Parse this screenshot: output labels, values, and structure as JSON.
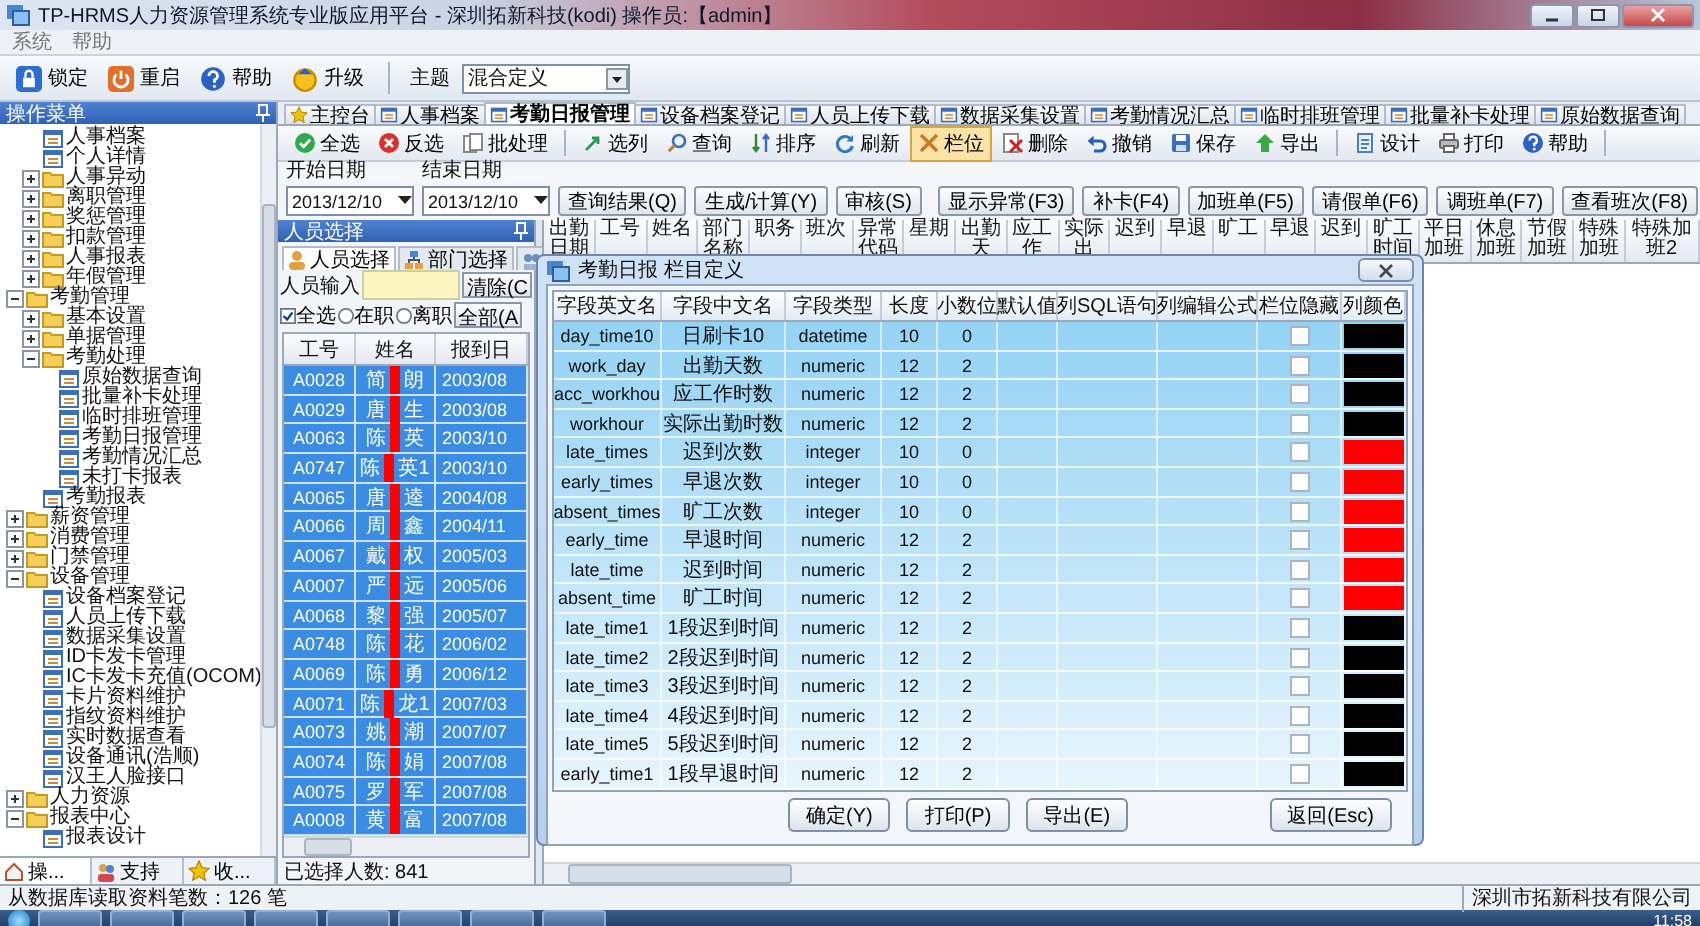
{
  "window": {
    "title": "TP-HRMS人力资源管理系统专业版应用平台 - 深圳拓新科技(kodi) 操作员:【admin】"
  },
  "menu": [
    "系统",
    "帮助"
  ],
  "main_toolbar": [
    {
      "label": "锁定"
    },
    {
      "label": "重启"
    },
    {
      "label": "帮助"
    },
    {
      "label": "升级"
    }
  ],
  "theme": {
    "label": "主题",
    "value": "混合定义"
  },
  "side_panel": {
    "title": "操作菜单",
    "tree": [
      {
        "children": [
          {
            "kind": "leaf",
            "label": "人事档案"
          },
          {
            "kind": "leaf",
            "label": "个人详情"
          },
          {
            "kind": "folder",
            "label": "人事异动",
            "expanded": false
          },
          {
            "kind": "folder",
            "label": "离职管理",
            "expanded": false
          },
          {
            "kind": "folder",
            "label": "奖惩管理",
            "expanded": false
          },
          {
            "kind": "folder",
            "label": "扣款管理",
            "expanded": false
          },
          {
            "kind": "folder",
            "label": "人事报表",
            "expanded": false
          },
          {
            "kind": "folder",
            "label": "年假管理",
            "expanded": false
          }
        ]
      },
      {
        "kind": "folder",
        "label": "考勤管理",
        "expanded": true,
        "children": [
          {
            "kind": "folder",
            "label": "基本设置",
            "expanded": false
          },
          {
            "kind": "folder",
            "label": "单据管理",
            "expanded": false
          },
          {
            "kind": "folder",
            "label": "考勤处理",
            "expanded": true,
            "children": [
              {
                "kind": "leaf",
                "label": "原始数据查询"
              },
              {
                "kind": "leaf",
                "label": "批量补卡处理"
              },
              {
                "kind": "leaf",
                "label": "临时排班管理"
              },
              {
                "kind": "leaf",
                "label": "考勤日报管理"
              },
              {
                "kind": "leaf",
                "label": "考勤情况汇总"
              },
              {
                "kind": "leaf",
                "label": "未打卡报表"
              }
            ]
          },
          {
            "kind": "leaf",
            "label": "考勤报表"
          }
        ]
      },
      {
        "kind": "folder",
        "label": "薪资管理",
        "expanded": false
      },
      {
        "kind": "folder",
        "label": "消费管理",
        "expanded": false
      },
      {
        "kind": "folder",
        "label": "门禁管理",
        "expanded": false
      },
      {
        "kind": "folder",
        "label": "设备管理",
        "expanded": true,
        "children": [
          {
            "kind": "leaf",
            "label": "设备档案登记"
          },
          {
            "kind": "leaf",
            "label": "人员上传下载"
          },
          {
            "kind": "leaf",
            "label": "数据采集设置"
          },
          {
            "kind": "leaf",
            "label": "ID卡发卡管理"
          },
          {
            "kind": "leaf",
            "label": "IC卡发卡充值(OCOM)"
          },
          {
            "kind": "leaf",
            "label": "卡片资料维护"
          },
          {
            "kind": "leaf",
            "label": "指纹资料维护"
          },
          {
            "kind": "leaf",
            "label": "实时数据查看"
          },
          {
            "kind": "leaf",
            "label": "设备通讯(浩顺)"
          },
          {
            "kind": "leaf",
            "label": "汉王人脸接口"
          }
        ]
      },
      {
        "kind": "folder",
        "label": "人力资源",
        "expanded": false
      },
      {
        "kind": "folder",
        "label": "报表中心",
        "expanded": true,
        "children": [
          {
            "kind": "leaf",
            "label": "报表设计"
          }
        ]
      }
    ],
    "tabs": [
      {
        "label": "操...",
        "selected": true
      },
      {
        "label": "支持",
        "selected": false
      },
      {
        "label": "收...",
        "selected": false
      }
    ]
  },
  "tabs": [
    {
      "label": "主控台",
      "selected": false
    },
    {
      "label": "人事档案",
      "selected": false
    },
    {
      "label": "考勤日报管理",
      "selected": true
    },
    {
      "label": "设备档案登记",
      "selected": false
    },
    {
      "label": "人员上传下载",
      "selected": false
    },
    {
      "label": "数据采集设置",
      "selected": false
    },
    {
      "label": "考勤情况汇总",
      "selected": false
    },
    {
      "label": "临时排班管理",
      "selected": false
    },
    {
      "label": "批量补卡处理",
      "selected": false
    },
    {
      "label": "原始数据查询",
      "selected": false
    }
  ],
  "toolbar": [
    [
      {
        "label": "全选",
        "selected": false
      },
      {
        "label": "反选",
        "selected": false
      },
      {
        "label": "批处理",
        "selected": false
      }
    ],
    [
      {
        "label": "选列",
        "selected": false
      },
      {
        "label": "查询",
        "selected": false
      },
      {
        "label": "排序",
        "selected": false
      },
      {
        "label": "刷新",
        "selected": false
      },
      {
        "label": "栏位",
        "selected": true
      },
      {
        "label": "删除",
        "selected": false
      },
      {
        "label": "撤销",
        "selected": false
      },
      {
        "label": "保存",
        "selected": false
      },
      {
        "label": "导出",
        "selected": false
      }
    ],
    [
      {
        "label": "设计",
        "selected": false
      },
      {
        "label": "打印",
        "selected": false
      },
      {
        "label": "帮助",
        "selected": false
      }
    ]
  ],
  "filters": {
    "start": {
      "label": "开始日期",
      "value": "2013/12/10"
    },
    "end": {
      "label": "结束日期",
      "value": "2013/12/10"
    },
    "actions": [
      "查询结果(Q)",
      "生成/计算(Y)",
      "审核(S)"
    ],
    "shortcuts": [
      "显示异常(F3)",
      "补卡(F4)",
      "加班单(F5)",
      "请假单(F6)",
      "调班单(F7)",
      "查看班次(F8)"
    ]
  },
  "person_panel": {
    "title": "人员选择",
    "tabs": [
      {
        "label": "人员选择",
        "selected": true
      },
      {
        "label": "部门选择",
        "selected": false
      },
      {
        "selected": false
      }
    ],
    "input_label": "人员输入",
    "clear_button": "清除(C",
    "select_all": {
      "label": "全选",
      "checked": true
    },
    "radios": [
      {
        "label": "在职",
        "selected": false
      },
      {
        "label": "离职",
        "selected": false
      }
    ],
    "all_button": "全部(A",
    "columns": [
      "工号",
      "姓名",
      "报到日"
    ],
    "rows": [
      {
        "id": "A0028",
        "name": [
          "简",
          "朗"
        ],
        "date": "2003/08",
        "selected": true
      },
      {
        "id": "A0029",
        "name": [
          "唐",
          "生"
        ],
        "date": "2003/08",
        "selected": true
      },
      {
        "id": "A0063",
        "name": [
          "陈",
          "英"
        ],
        "date": "2003/10",
        "selected": true
      },
      {
        "id": "A0747",
        "name": [
          "陈",
          "英1"
        ],
        "date": "2003/10",
        "selected": true
      },
      {
        "id": "A0065",
        "name": [
          "唐",
          "逵"
        ],
        "date": "2004/08",
        "selected": true
      },
      {
        "id": "A0066",
        "name": [
          "周",
          "鑫"
        ],
        "date": "2004/11",
        "selected": true
      },
      {
        "id": "A0067",
        "name": [
          "戴",
          "权"
        ],
        "date": "2005/03",
        "selected": true
      },
      {
        "id": "A0007",
        "name": [
          "严",
          "远"
        ],
        "date": "2005/06",
        "selected": true
      },
      {
        "id": "A0068",
        "name": [
          "黎",
          "强"
        ],
        "date": "2005/07",
        "selected": true
      },
      {
        "id": "A0748",
        "name": [
          "陈",
          "花"
        ],
        "date": "2006/02",
        "selected": true
      },
      {
        "id": "A0069",
        "name": [
          "陈",
          "勇"
        ],
        "date": "2006/12",
        "selected": true
      },
      {
        "id": "A0071",
        "name": [
          "陈",
          "龙1"
        ],
        "date": "2007/03",
        "selected": true
      },
      {
        "id": "A0073",
        "name": [
          "姚",
          "潮"
        ],
        "date": "2007/07",
        "selected": true
      },
      {
        "id": "A0074",
        "name": [
          "陈",
          "娟"
        ],
        "date": "2007/08",
        "selected": true
      },
      {
        "id": "A0075",
        "name": [
          "罗",
          "军"
        ],
        "date": "2007/08",
        "selected": true
      },
      {
        "id": "A0008",
        "name": [
          "黄",
          "富"
        ],
        "date": "2007/08",
        "selected": true
      }
    ],
    "count": "已选择人数: 841"
  },
  "grid": {
    "columns": [
      "出勤日期",
      "工号",
      "姓名",
      "部门名称",
      "职务",
      "班次",
      "异常代码",
      "星期",
      "出勤天",
      "应工作",
      "实际出",
      "迟到",
      "早退",
      "旷工",
      "早退",
      "迟到",
      "旷工时间",
      "平日加班",
      "休息加班",
      "节假加班",
      "特殊加班",
      "特殊加班2"
    ]
  },
  "dialog": {
    "title": "考勤日报 栏目定义",
    "columns": [
      "字段英文名",
      "字段中文名",
      "字段类型",
      "长度",
      "小数位",
      "默认值",
      "列SQL语句",
      "列编辑公式",
      "栏位隐藏",
      "列颜色"
    ],
    "rows": [
      {
        "en": "day_time10",
        "cn": "日刷卡10",
        "type": "datetime",
        "length": "10",
        "decimals": "0",
        "hidden": false,
        "color": "#000000"
      },
      {
        "en": "work_day",
        "cn": "出勤天数",
        "type": "numeric",
        "length": "12",
        "decimals": "2",
        "hidden": false,
        "color": "#000000"
      },
      {
        "en": "acc_workhou",
        "cn": "应工作时数",
        "type": "numeric",
        "length": "12",
        "decimals": "2",
        "hidden": false,
        "color": "#000000"
      },
      {
        "en": "workhour",
        "cn": "实际出勤时数",
        "type": "numeric",
        "length": "12",
        "decimals": "2",
        "hidden": false,
        "color": "#000000"
      },
      {
        "en": "late_times",
        "cn": "迟到次数",
        "type": "integer",
        "length": "10",
        "decimals": "0",
        "hidden": false,
        "color": "#ff0000"
      },
      {
        "en": "early_times",
        "cn": "早退次数",
        "type": "integer",
        "length": "10",
        "decimals": "0",
        "hidden": false,
        "color": "#ff0000"
      },
      {
        "en": "absent_times",
        "cn": "旷工次数",
        "type": "integer",
        "length": "10",
        "decimals": "0",
        "hidden": false,
        "color": "#ff0000"
      },
      {
        "en": "early_time",
        "cn": "早退时间",
        "type": "numeric",
        "length": "12",
        "decimals": "2",
        "hidden": false,
        "color": "#ff0000"
      },
      {
        "en": "late_time",
        "cn": "迟到时间",
        "type": "numeric",
        "length": "12",
        "decimals": "2",
        "hidden": false,
        "color": "#ff0000"
      },
      {
        "en": "absent_time",
        "cn": "旷工时间",
        "type": "numeric",
        "length": "12",
        "decimals": "2",
        "hidden": false,
        "color": "#ff0000"
      },
      {
        "en": "late_time1",
        "cn": "1段迟到时间",
        "type": "numeric",
        "length": "12",
        "decimals": "2",
        "hidden": false,
        "color": "#000000"
      },
      {
        "en": "late_time2",
        "cn": "2段迟到时间",
        "type": "numeric",
        "length": "12",
        "decimals": "2",
        "hidden": false,
        "color": "#000000"
      },
      {
        "en": "late_time3",
        "cn": "3段迟到时间",
        "type": "numeric",
        "length": "12",
        "decimals": "2",
        "hidden": false,
        "color": "#000000"
      },
      {
        "en": "late_time4",
        "cn": "4段迟到时间",
        "type": "numeric",
        "length": "12",
        "decimals": "2",
        "hidden": false,
        "color": "#000000"
      },
      {
        "en": "late_time5",
        "cn": "5段迟到时间",
        "type": "numeric",
        "length": "12",
        "decimals": "2",
        "hidden": false,
        "color": "#000000"
      },
      {
        "en": "early_time1",
        "cn": "1段早退时间",
        "type": "numeric",
        "length": "12",
        "decimals": "2",
        "hidden": false,
        "color": "#000000"
      }
    ],
    "buttons": [
      "确定(Y)",
      "打印(P)",
      "导出(E)"
    ],
    "back_button": "返回(Esc)"
  },
  "status_bar": {
    "left": "从数据库读取资料笔数：126 笔",
    "right": "深圳市拓新科技有限公司"
  },
  "taskbar": {
    "clock": "11:58"
  }
}
